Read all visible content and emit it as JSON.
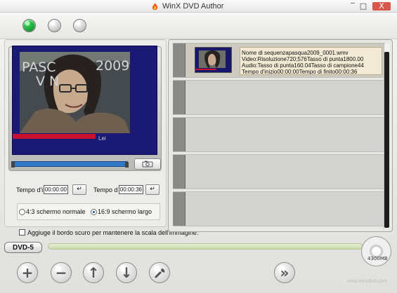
{
  "app": {
    "title": "WinX DVD Author"
  },
  "window_controls": {
    "minimize": "‾",
    "maximize": "□",
    "close": "X"
  },
  "status_lights": [
    "active",
    "inactive",
    "inactive"
  ],
  "preview": {
    "overlay_year": "2009",
    "overlay_letters": "PASC",
    "overlay_label": "V N",
    "red_caption": "Lei"
  },
  "time": {
    "start_label": "Tempo d'i",
    "start_value": "00:00:00",
    "end_label": "Tempo d",
    "end_value": "00:00:36"
  },
  "aspect": {
    "normal": "4:3 schermo normale",
    "wide": "16:9 schermo largo",
    "selected": "wide"
  },
  "border_option": "Aggiuge il bordo scuro per mantenere la scala dell'immagine.",
  "clip": {
    "lines": [
      "Nome di sequenzapasqua2009_0001.wmv",
      "Video:Risoluzione720;576Tasso di punta1800.00",
      "Audio:Tasso di punta160.04Tasso di campione44",
      "Tempo d'inizio00:00:00Tempo di finito00:00:36"
    ]
  },
  "disc": {
    "badge": "DVD-5",
    "capacity": "4300MB"
  },
  "watermark": "www.winxdvd.com",
  "colors": {
    "accent": "#2f79c8",
    "status_active": "#2fc64f",
    "capacity": "#c9dba9",
    "selected_clip": "#f2ead5"
  }
}
